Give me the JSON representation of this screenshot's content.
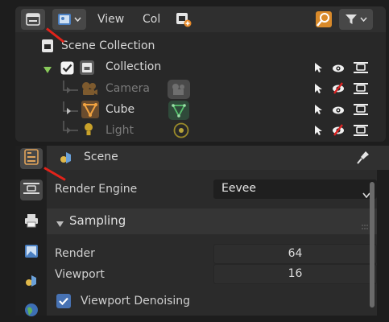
{
  "outliner": {
    "header": {
      "menu_view": "View",
      "menu_col": "Col"
    },
    "rows": [
      {
        "name": "Scene Collection"
      },
      {
        "name": "Collection"
      },
      {
        "name": "Camera"
      },
      {
        "name": "Cube"
      },
      {
        "name": "Light"
      }
    ]
  },
  "properties": {
    "context": "Scene",
    "render_engine": {
      "label": "Render Engine",
      "value": "Eevee"
    },
    "sampling": {
      "title": "Sampling",
      "render": {
        "label": "Render",
        "value": "64"
      },
      "viewport": {
        "label": "Viewport",
        "value": "16"
      }
    },
    "viewport_denoising": {
      "label": "Viewport Denoising",
      "checked": true
    }
  },
  "colors": {
    "accent_blue": "#4772b3",
    "collection_check": "#ffffff",
    "object_orange": "#e8983c",
    "data_green": "#57c26e",
    "annotation_red": "#e2231a"
  }
}
